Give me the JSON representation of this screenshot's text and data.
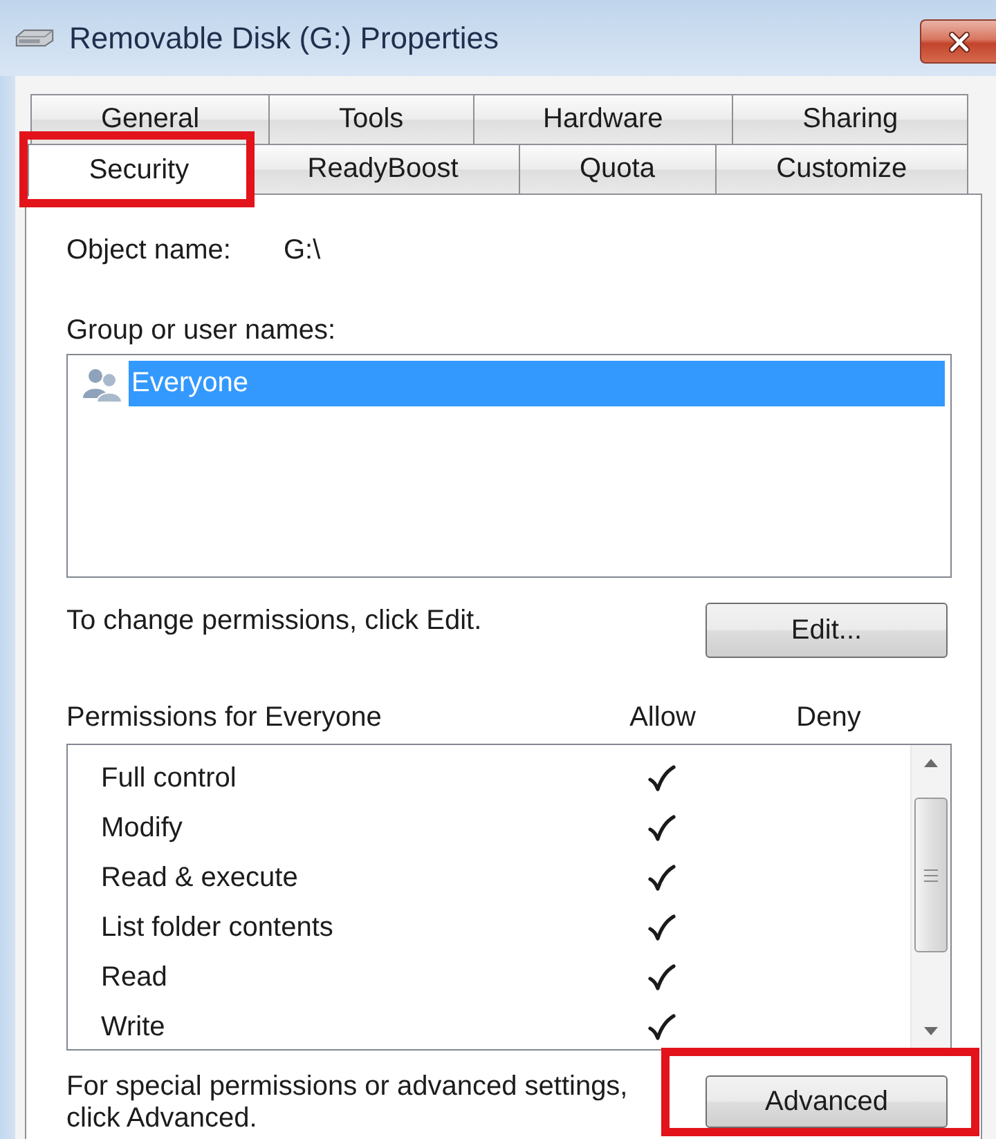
{
  "window": {
    "title": "Removable Disk (G:) Properties"
  },
  "tab_rows": [
    {
      "tabs": [
        {
          "label": "General",
          "selected": false,
          "highlighted": false
        },
        {
          "label": "Tools",
          "selected": false,
          "highlighted": false
        },
        {
          "label": "Hardware",
          "selected": false,
          "highlighted": false
        },
        {
          "label": "Sharing",
          "selected": false,
          "highlighted": false
        }
      ]
    },
    {
      "tabs": [
        {
          "label": "Security",
          "selected": true,
          "highlighted": true
        },
        {
          "label": "ReadyBoost",
          "selected": false,
          "highlighted": false
        },
        {
          "label": "Quota",
          "selected": false,
          "highlighted": false
        },
        {
          "label": "Customize",
          "selected": false,
          "highlighted": false
        }
      ]
    }
  ],
  "object_name": {
    "label": "Object name:",
    "value": "G:\\"
  },
  "group_list": {
    "label": "Group or user names:",
    "items": [
      {
        "name": "Everyone",
        "selected": true
      }
    ]
  },
  "edit_hint": "To change permissions, click Edit.",
  "edit_button": {
    "label": "Edit...",
    "highlighted": false
  },
  "permissions": {
    "title": "Permissions for Everyone",
    "columns": [
      "Allow",
      "Deny"
    ],
    "rows": [
      {
        "name": "Full control",
        "allow": true,
        "deny": false
      },
      {
        "name": "Modify",
        "allow": true,
        "deny": false
      },
      {
        "name": "Read & execute",
        "allow": true,
        "deny": false
      },
      {
        "name": "List folder contents",
        "allow": true,
        "deny": false
      },
      {
        "name": "Read",
        "allow": true,
        "deny": false
      },
      {
        "name": "Write",
        "allow": true,
        "deny": false
      }
    ]
  },
  "advanced_hint": "For special permissions or advanced settings, click Advanced.",
  "advanced_button": {
    "label": "Advanced",
    "highlighted": true
  }
}
